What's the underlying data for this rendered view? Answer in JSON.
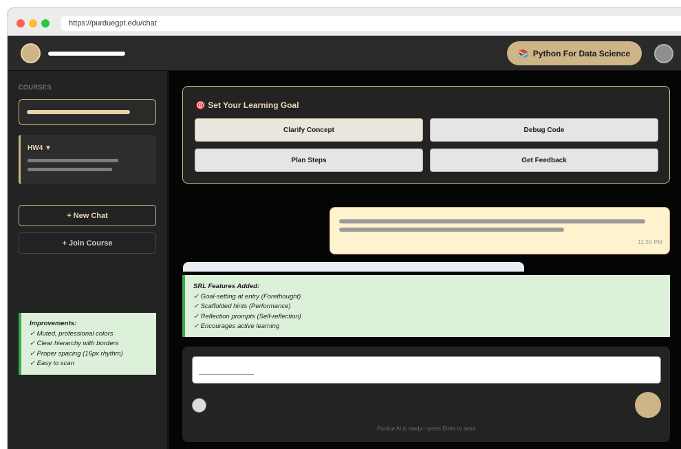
{
  "browser": {
    "url": "https://purduegpt.edu/chat"
  },
  "header": {
    "course_pill": {
      "icon": "books-icon",
      "icon_glyph": "📚",
      "label": "Python For Data Science"
    }
  },
  "sidebar": {
    "section_label": "COURSES",
    "assignment_label": "HW4 ▼",
    "new_chat_label": "+ New Chat",
    "join_course_label": "+ Join Course",
    "note": {
      "title": "Improvements:",
      "items": [
        "✓ Muted, professional colors",
        "✓ Clear hierarchy with borders",
        "✓ Proper spacing (16px rhythm)",
        "✓ Easy to scan"
      ]
    }
  },
  "goal": {
    "icon": "target-icon",
    "icon_glyph": "🎯",
    "title": "Set Your Learning Goal",
    "buttons": [
      "Clarify Concept",
      "Debug Code",
      "Plan Steps",
      "Get Feedback"
    ]
  },
  "chat": {
    "user_message_time": "11:24 PM"
  },
  "main_note": {
    "title": "SRL Features Added:",
    "items": [
      "✓ Goal-setting at entry (Forethought)",
      "✓ Scaffolded hints (Performance)",
      "✓ Reflection prompts (Self-reflection)",
      "✓ Encourages active learning"
    ]
  },
  "composer": {
    "status": "Purdue AI is ready—press Enter to send"
  },
  "colors": {
    "accent_gold": "#cdb587",
    "background_dark": "#050505",
    "panel_dark": "#232323",
    "note_green_bg": "#dcf0da",
    "note_green_border": "#3aaa4a",
    "user_bubble": "#fef3cd"
  }
}
